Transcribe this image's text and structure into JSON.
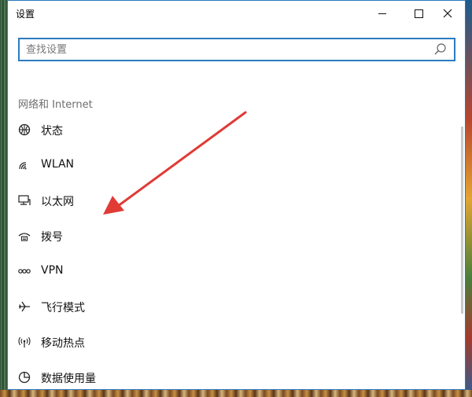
{
  "window": {
    "title": "设置",
    "controls": [
      "minimize-icon",
      "maximize-icon",
      "close-icon"
    ]
  },
  "search": {
    "placeholder": "查找设置",
    "icon": "search-icon"
  },
  "section": {
    "title": "网络和 Internet"
  },
  "items": [
    {
      "label": "状态",
      "icon": "globe-status-icon"
    },
    {
      "label": "WLAN",
      "icon": "wifi-icon"
    },
    {
      "label": "以太网",
      "icon": "ethernet-monitor-icon"
    },
    {
      "label": "拨号",
      "icon": "dialup-icon"
    },
    {
      "label": "VPN",
      "icon": "vpn-icon"
    },
    {
      "label": "飞行模式",
      "icon": "airplane-icon"
    },
    {
      "label": "移动热点",
      "icon": "hotspot-icon"
    },
    {
      "label": "数据使用量",
      "icon": "data-usage-icon"
    }
  ],
  "colors": {
    "accent": "#2b7bc0",
    "annotation_arrow": "#e03b35"
  }
}
